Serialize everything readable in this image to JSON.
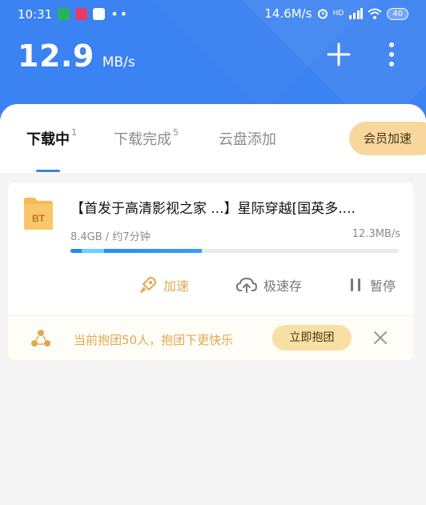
{
  "status_bar": {
    "time": "10:31",
    "network_speed": "14.6M/s",
    "signal_text": "HD",
    "battery": "40"
  },
  "header": {
    "speed_value": "12.9",
    "speed_unit": "MB/s"
  },
  "tabs": [
    {
      "label": "下载中",
      "count": "1",
      "active": true
    },
    {
      "label": "下载完成",
      "count": "5",
      "active": false
    },
    {
      "label": "云盘添加",
      "count": "",
      "active": false
    }
  ],
  "vip_button": {
    "label": "会员加速"
  },
  "download": {
    "icon_text": "BT",
    "title": "【首发于高清影视之家 ...】星际穿越[国英多....",
    "size_info": "8.4GB / 约7分钟",
    "speed": "12.3MB/s",
    "progress": 0.4,
    "actions": {
      "accelerate": "加速",
      "fast_save": "极速存",
      "pause": "暂停"
    }
  },
  "group_promo": {
    "text": "当前抱团50人，抱团下更快乐",
    "button": "立即抱团"
  },
  "colors": {
    "header_blue": "#3b82f2",
    "gold": "#e0a94d",
    "vip_bg": "#f7d79c"
  }
}
